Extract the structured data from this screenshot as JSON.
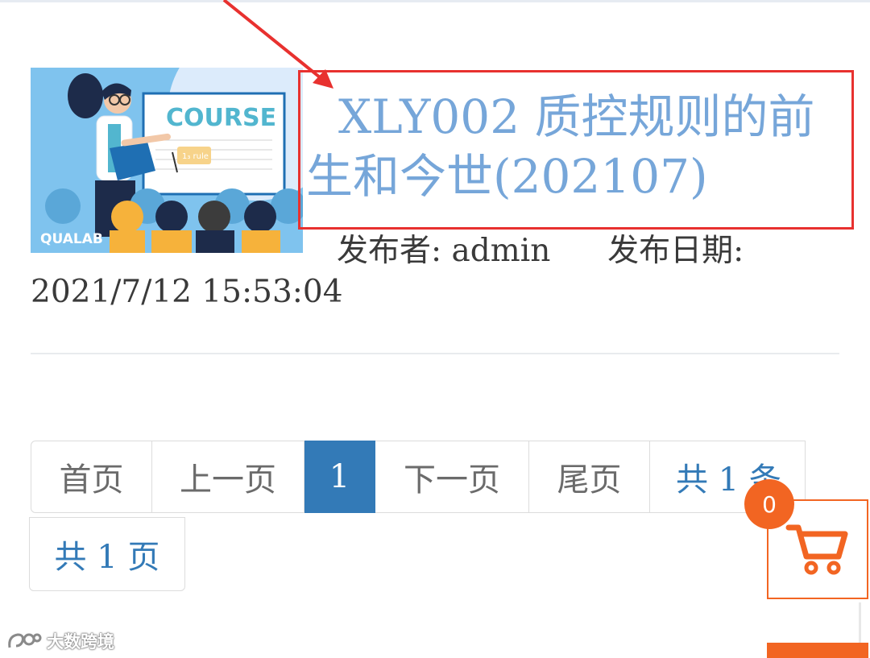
{
  "article": {
    "title_line1": "XLY002 质控规则的前",
    "title_line2": "生和今世(202107)",
    "thumbnail": {
      "board_text": "COURSE",
      "bubble_text": "1₃ rule",
      "logo_text": "QUALAB"
    },
    "publisher_label": "发布者:",
    "publisher": "admin",
    "date_label": "发布日期:",
    "date": "2021/7/12 15:53:04"
  },
  "pagination": {
    "first": "首页",
    "prev": "上一页",
    "current": "1",
    "next": "下一页",
    "last": "尾页",
    "total_items": "共 1 条",
    "total_pages": "共 1 页"
  },
  "cart": {
    "count": "0",
    "icon": "cart-icon",
    "color": "#f26522"
  },
  "watermark": {
    "text": "大数跨境"
  },
  "colors": {
    "title": "#76a6d9",
    "annotation": "#e8312f",
    "pager_active": "#337ab7"
  }
}
